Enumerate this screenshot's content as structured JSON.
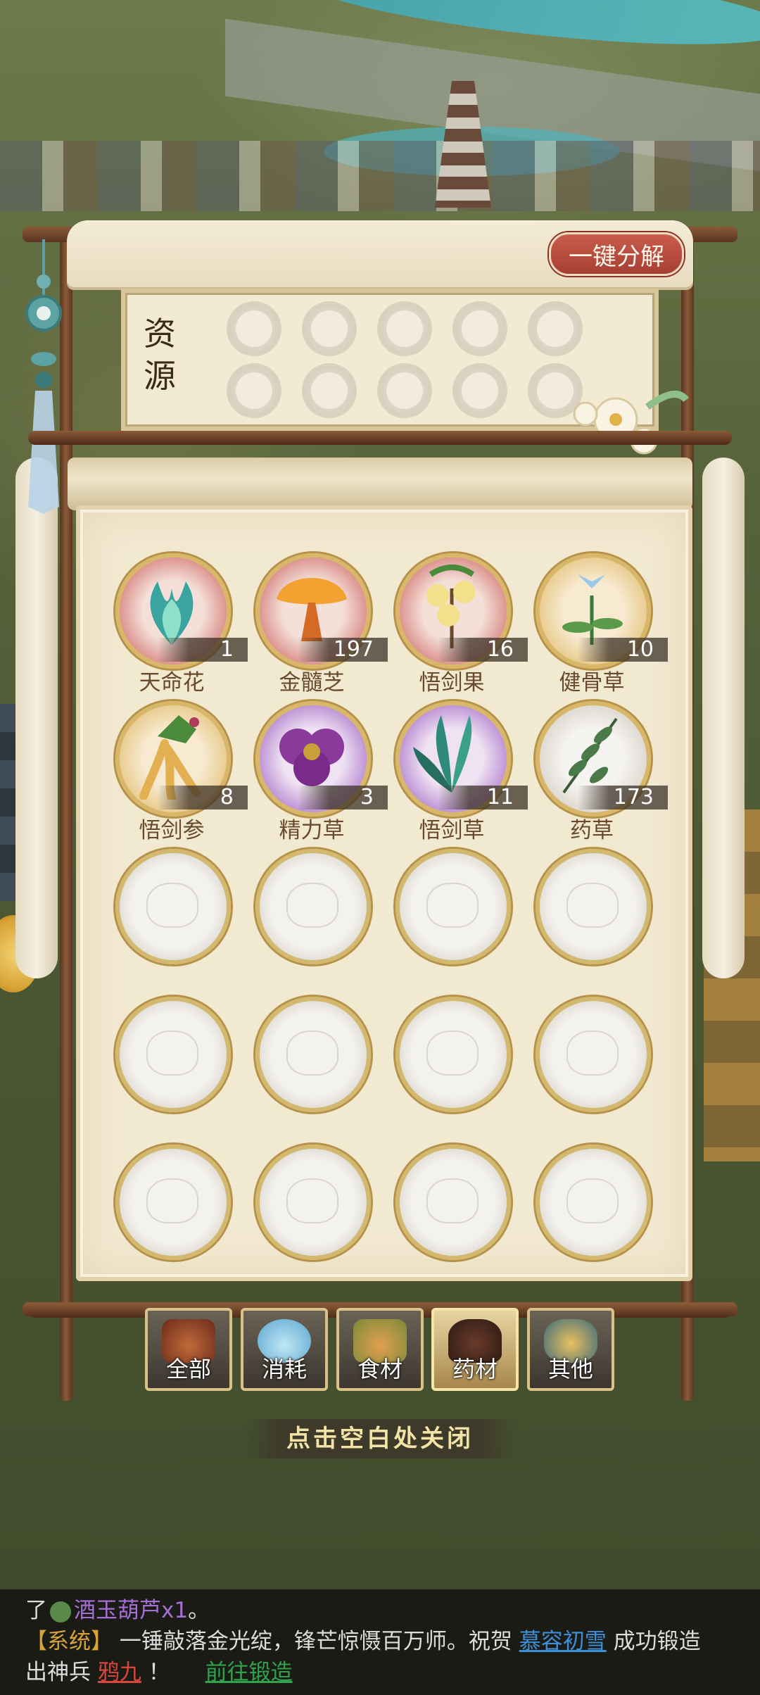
{
  "panel": {
    "decompose_label": "一键分解",
    "resource_title": "资源"
  },
  "items": [
    {
      "name": "天命花",
      "count": "1",
      "tone": "red"
    },
    {
      "name": "金髓芝",
      "count": "197",
      "tone": "red"
    },
    {
      "name": "悟剑果",
      "count": "16",
      "tone": "red"
    },
    {
      "name": "健骨草",
      "count": "10",
      "tone": "gold"
    },
    {
      "name": "悟剑参",
      "count": "8",
      "tone": "gold"
    },
    {
      "name": "精力草",
      "count": "3",
      "tone": "purple"
    },
    {
      "name": "悟剑草",
      "count": "11",
      "tone": "purple"
    },
    {
      "name": "药草",
      "count": "173",
      "tone": "gray"
    }
  ],
  "tabs": [
    {
      "label": "全部",
      "icon": "treasure-chest-icon",
      "active": false
    },
    {
      "label": "消耗",
      "icon": "potion-bottle-icon",
      "active": false
    },
    {
      "label": "食材",
      "icon": "food-basket-icon",
      "active": false
    },
    {
      "label": "药材",
      "icon": "herb-pot-icon",
      "active": true
    },
    {
      "label": "其他",
      "icon": "gold-jar-icon",
      "active": false
    }
  ],
  "close_hint": "点击空白处关闭",
  "chat": {
    "line1_prefix": "了",
    "line1_item": "酒玉葫芦x1",
    "line1_suffix": "。",
    "line2_tag": "【系统】",
    "line2_text": "一锤敲落金光绽，锋芒惊慑百万师。祝贺",
    "line2_player": "慕容初雪",
    "line2_end": "成功锻造",
    "line3_text": "出神兵",
    "line3_weapon": "鸦九",
    "line3_mark": "！",
    "line3_link": "前往锻造"
  }
}
